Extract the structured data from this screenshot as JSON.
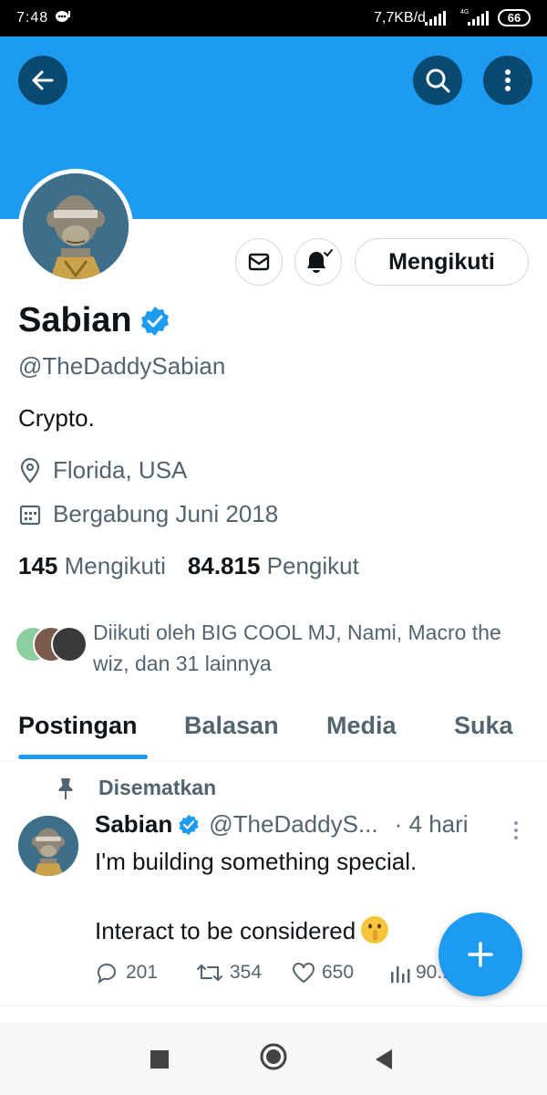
{
  "status_bar": {
    "time": "7:48",
    "network_speed": "7,7KB/d",
    "network_type": "4G",
    "battery": "66"
  },
  "header": {
    "back_icon": "arrow-left-icon",
    "search_icon": "search-icon",
    "more_icon": "more-vertical-icon",
    "banner_color": "#1d9bf0"
  },
  "profile": {
    "name": "Sabian",
    "handle": "@TheDaddySabian",
    "bio": "Crypto.",
    "location": "Florida, USA",
    "joined": "Bergabung Juni 2018",
    "following_count": "145",
    "following_label": "Mengikuti",
    "followers_count": "84.815",
    "followers_label": "Pengikut",
    "followed_by": "Diikuti oleh BIG COOL MJ, Nami, Macro the wiz, dan 31 lainnya",
    "follow_button": "Mengikuti"
  },
  "tabs": [
    {
      "label": "Postingan",
      "active": true
    },
    {
      "label": "Balasan",
      "active": false
    },
    {
      "label": "Media",
      "active": false
    },
    {
      "label": "Suka",
      "active": false
    }
  ],
  "pinned_post": {
    "pinned_label": "Disematkan",
    "author_name": "Sabian",
    "author_handle": "@TheDaddyS...",
    "time": "· 4 hari",
    "text": "I'm building something special.\n\nInteract to be considered",
    "emoji": "shushing-face",
    "replies": "201",
    "reposts": "354",
    "likes": "650",
    "views": "90..."
  },
  "colors": {
    "accent": "#1d9bf0",
    "text_primary": "#0f1419",
    "text_secondary": "#536471"
  }
}
